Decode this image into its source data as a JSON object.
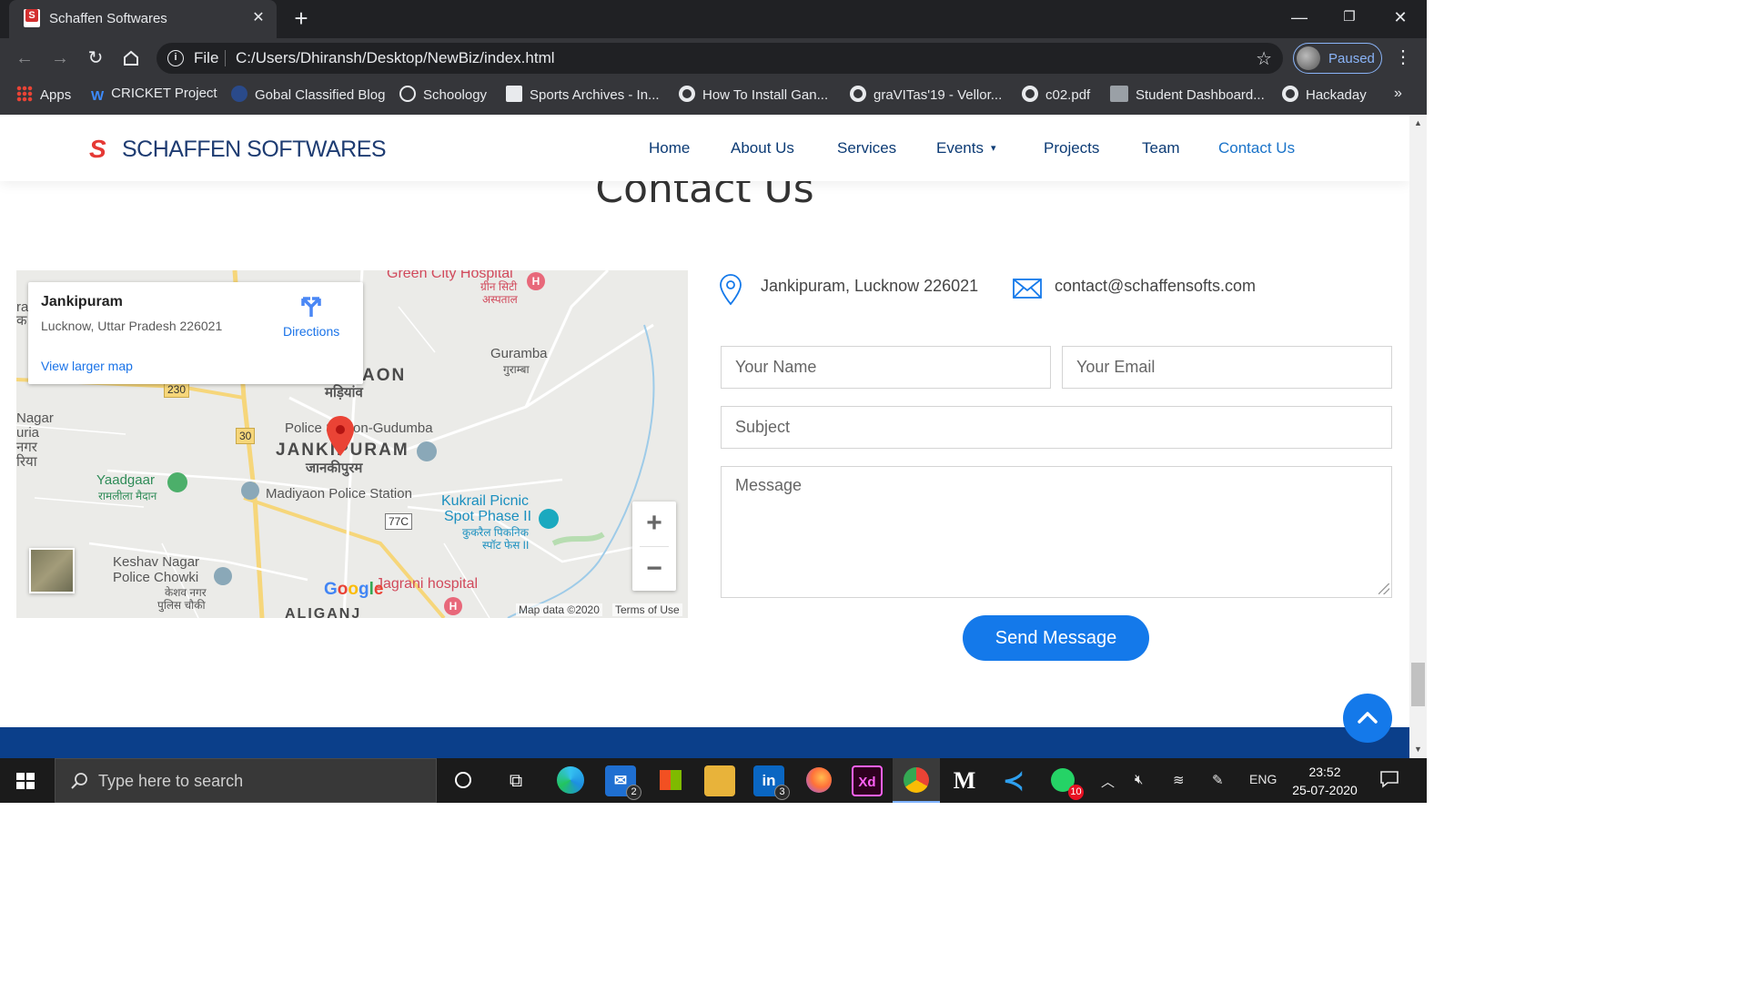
{
  "browser": {
    "tab_title": "Schaffen Softwares",
    "scheme_label": "File",
    "url": "C:/Users/Dhiransh/Desktop/NewBiz/index.html",
    "profile_label": "Paused",
    "bookmarks": [
      {
        "label": "Apps",
        "icon": "apps-grid-icon"
      },
      {
        "label": "CRICKET Project",
        "icon": "wix-icon"
      },
      {
        "label": "Gobal Classified Blog",
        "icon": "blog-icon"
      },
      {
        "label": "Schoology",
        "icon": "schoology-icon"
      },
      {
        "label": "Sports Archives - In...",
        "icon": "site-icon"
      },
      {
        "label": "How To Install Gan...",
        "icon": "globe-icon"
      },
      {
        "label": "graVITas'19 - Vellor...",
        "icon": "globe-icon"
      },
      {
        "label": "c02.pdf",
        "icon": "globe-icon"
      },
      {
        "label": "Student Dashboard...",
        "icon": "ep-icon"
      },
      {
        "label": "Hackaday",
        "icon": "globe-icon"
      }
    ]
  },
  "site": {
    "logo_mark": "S",
    "logo_text": "SCHAFFEN SOFTWARES",
    "nav": [
      {
        "label": "Home"
      },
      {
        "label": "About Us"
      },
      {
        "label": "Services"
      },
      {
        "label": "Events"
      },
      {
        "label": "Projects"
      },
      {
        "label": "Team"
      },
      {
        "label": "Contact Us"
      }
    ],
    "section_title": "Contact Us"
  },
  "map": {
    "place_name": "Jankipuram",
    "place_address": "Lucknow, Uttar Pradesh 226021",
    "directions_label": "Directions",
    "larger_map_label": "View larger map",
    "zoom_in": "+",
    "zoom_out": "−",
    "map_data": "Map data ©2020",
    "terms": "Terms of Use",
    "google": "Google",
    "labels": {
      "green_city": "Green City Hospital",
      "green_city_hi": "ग्रीन सिटी",
      "hospital_hi": "अस्पताल",
      "guramba": "Guramba",
      "guramba_hi": "गुराम्बा",
      "aon": "AON",
      "madiyanv": "मड़ियांव",
      "police_station": "Police Station-Gudumba",
      "jankipuram": "JANKIPURAM",
      "jankipuram_hi": "जानकीपुरम",
      "yaadgaar": "Yaadgaar",
      "yaadgaar_hi": "रामलीला मैदान",
      "madiyaon_ps": "Madiyaon Police Station",
      "kukrail": "Kukrail Picnic",
      "spot_phase": "Spot Phase II",
      "kukrail_hi": "कुकरैल पिकनिक",
      "spot_hi": "स्पॉट फेस II",
      "keshav": "Keshav Nagar",
      "police_chowki": "Police Chowki",
      "keshav_hi": "केशव नगर",
      "chowki_hi": "पुलिस चौकी",
      "jagrani": "Jagrani hospital",
      "aliganj": "ALIGANJ",
      "road_230": "230",
      "road_30": "30",
      "road_77c": "77C",
      "left_nagar": "Nagar",
      "left_uria": "uria",
      "left_nagar_hi": "नगर",
      "left_riya": "रिया",
      "left_ra": "ra",
      "left_ka": "क"
    }
  },
  "contact": {
    "address": "Jankipuram, Lucknow 226021",
    "email": "contact@schaffensofts.com",
    "name_placeholder": "Your Name",
    "email_placeholder": "Your Email",
    "subject_placeholder": "Subject",
    "message_placeholder": "Message",
    "send_label": "Send Message"
  },
  "taskbar": {
    "search_placeholder": "Type here to search",
    "mail_badge": "2",
    "linkedin_badge": "3",
    "whatsapp_badge": "10",
    "language": "ENG",
    "time": "23:52",
    "date": "25-07-2020"
  },
  "colors": {
    "brand_blue": "#1479ea",
    "nav_blue": "#0c3b75",
    "logo_red": "#e53935",
    "footer_navy": "#0b3f8a"
  }
}
